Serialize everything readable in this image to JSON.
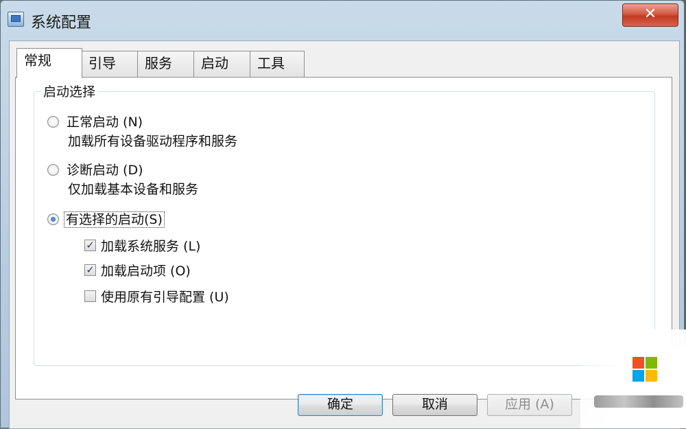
{
  "window": {
    "title": "系统配置",
    "close_symbol": "✕"
  },
  "tabs": [
    {
      "label": "常规",
      "active": true
    },
    {
      "label": "引导",
      "active": false
    },
    {
      "label": "服务",
      "active": false
    },
    {
      "label": "启动",
      "active": false
    },
    {
      "label": "工具",
      "active": false
    }
  ],
  "startup_selection": {
    "group_label": "启动选择",
    "options": [
      {
        "label": "正常启动 (N)",
        "description": "加载所有设备驱动程序和服务",
        "selected": false
      },
      {
        "label": "诊断启动 (D)",
        "description": "仅加载基本设备和服务",
        "selected": false
      },
      {
        "label": "有选择的启动(S)",
        "description": "",
        "selected": true
      }
    ],
    "checkboxes": [
      {
        "label": "加载系统服务 (L)",
        "checked": true,
        "check_mark": "✓"
      },
      {
        "label": "加载启动项 (O)",
        "checked": true,
        "check_mark": "✓"
      },
      {
        "label": "使用原有引导配置 (U)",
        "checked": false,
        "check_mark": ""
      }
    ]
  },
  "buttons": {
    "ok": "确定",
    "cancel": "取消",
    "apply": "应用 (A)"
  },
  "colors": {
    "titlebar": "#c9dbe9",
    "close_button": "#d45a43",
    "logo_red": "#f25022",
    "logo_green": "#7fba00",
    "logo_blue": "#00a4ef",
    "logo_yellow": "#ffb900"
  },
  "icons": [
    "system-config-icon",
    "close-icon",
    "radio-icon",
    "checkbox-icon",
    "windows-logo-icon"
  ]
}
